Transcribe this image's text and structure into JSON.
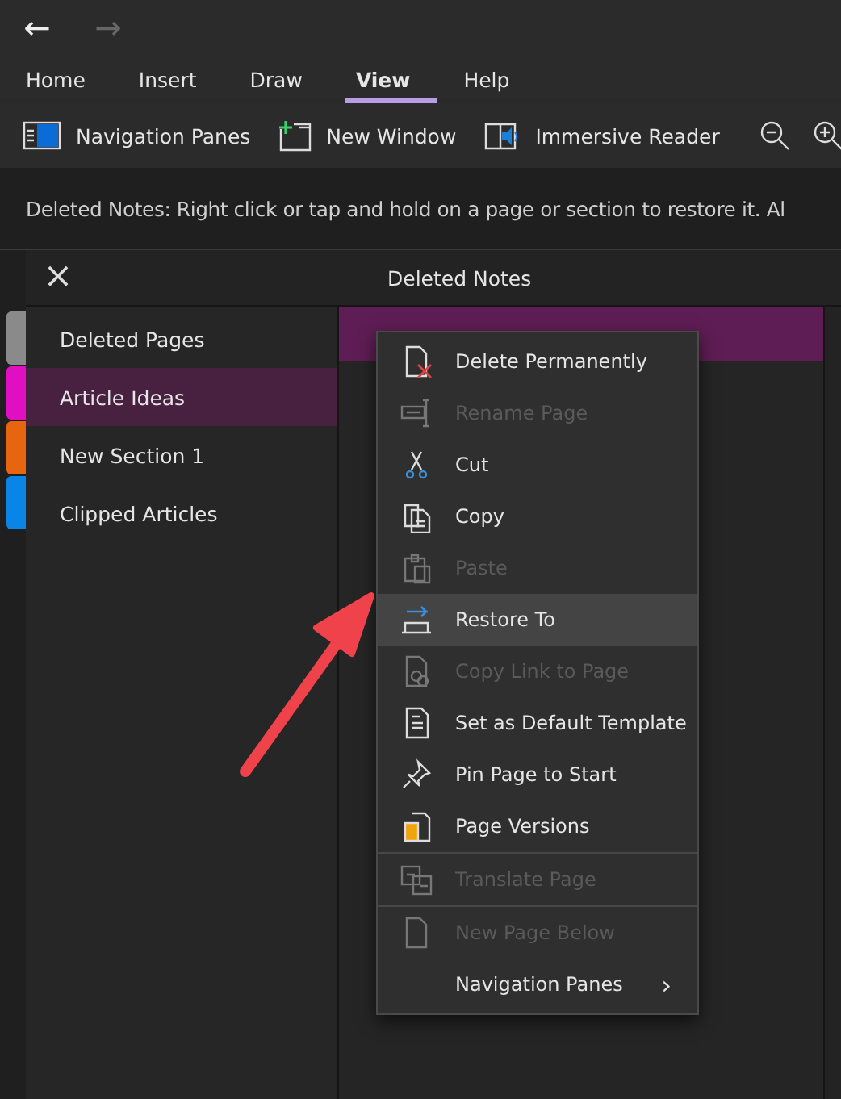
{
  "nav": {
    "back": "←",
    "forward": "→",
    "forward_disabled": true
  },
  "tabs": [
    {
      "label": "Home",
      "selected": false
    },
    {
      "label": "Insert",
      "selected": false
    },
    {
      "label": "Draw",
      "selected": false
    },
    {
      "label": "View",
      "selected": true
    },
    {
      "label": "Help",
      "selected": false
    }
  ],
  "ribbon": [
    "Navigation Panes",
    "New Window",
    "Immersive Reader"
  ],
  "info_bar": "Deleted Notes: Right click or tap and hold on a page or section to restore it. Al",
  "panel": {
    "close": "×",
    "title": "Deleted Notes",
    "sections": [
      {
        "label": "Deleted Pages",
        "color": "#8a8a8a",
        "selected": false
      },
      {
        "label": "Article Ideas",
        "color": "#e00fc2",
        "selected": true
      },
      {
        "label": "New Section 1",
        "color": "#e8650f",
        "selected": false
      },
      {
        "label": "Clipped Articles",
        "color": "#0a84e6",
        "selected": false
      }
    ],
    "pages": [
      {
        "selected": true
      }
    ]
  },
  "context_menu": [
    {
      "kind": "item",
      "label": "Delete Permanently",
      "disabled": false,
      "selected": false
    },
    {
      "kind": "item",
      "label": "Rename Page",
      "disabled": true,
      "selected": false
    },
    {
      "kind": "item",
      "label": "Cut",
      "disabled": false,
      "selected": false
    },
    {
      "kind": "item",
      "label": "Copy",
      "disabled": false,
      "selected": false
    },
    {
      "kind": "item",
      "label": "Paste",
      "disabled": true,
      "selected": false
    },
    {
      "kind": "item",
      "label": "Restore To",
      "disabled": false,
      "selected": true
    },
    {
      "kind": "item",
      "label": "Copy Link to Page",
      "disabled": true,
      "selected": false
    },
    {
      "kind": "item",
      "label": "Set as Default Template",
      "disabled": false,
      "selected": false
    },
    {
      "kind": "item",
      "label": "Pin Page to Start",
      "disabled": false,
      "selected": false
    },
    {
      "kind": "item",
      "label": "Page Versions",
      "disabled": false,
      "selected": false
    },
    {
      "kind": "separator"
    },
    {
      "kind": "item",
      "label": "Translate Page",
      "disabled": true,
      "selected": false
    },
    {
      "kind": "separator"
    },
    {
      "kind": "item",
      "label": "New Page Below",
      "disabled": true,
      "selected": false
    },
    {
      "kind": "submenu",
      "label": "Navigation Panes",
      "disabled": false,
      "selected": false,
      "arrow": "›"
    }
  ]
}
